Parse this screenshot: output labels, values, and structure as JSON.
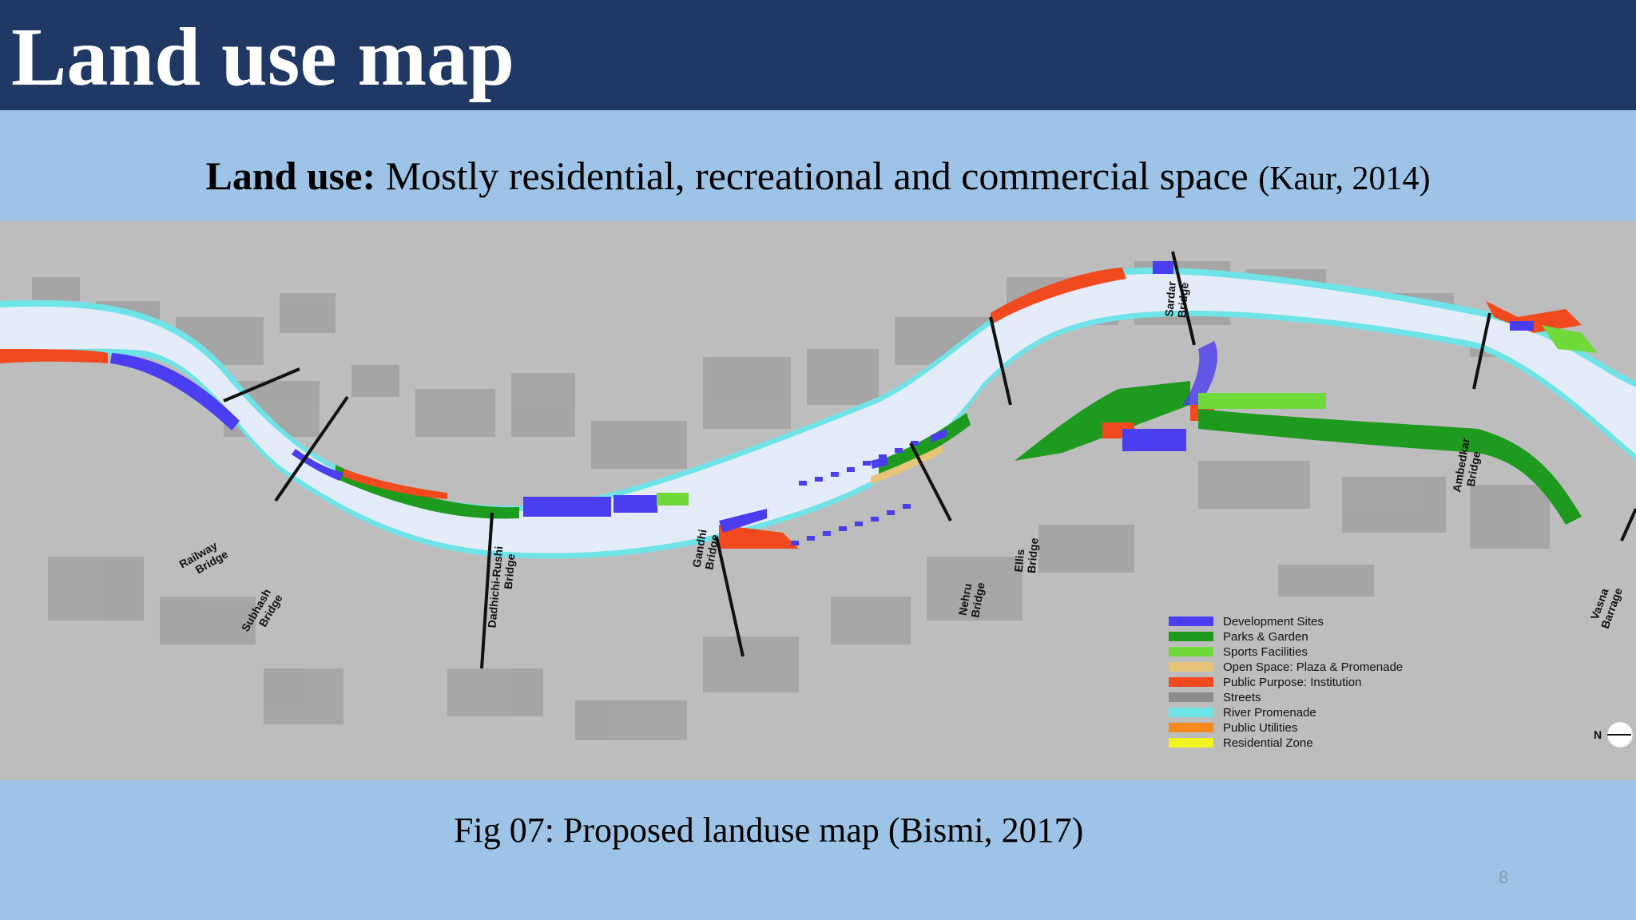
{
  "slide": {
    "title": "Land use map",
    "subtitle_label": "Land use:",
    "subtitle_text": " Mostly residential, recreational and commercial space ",
    "subtitle_citation": "(Kaur, 2014)",
    "caption": "Fig 07: Proposed landuse map (Bismi, 2017)",
    "page_number": "8"
  },
  "map": {
    "bridges": [
      {
        "lines": [
          "Railway",
          "Bridge"
        ]
      },
      {
        "lines": [
          "Subhash",
          "Bridge"
        ]
      },
      {
        "lines": [
          "Dadhichi-Rushi",
          "Bridge"
        ]
      },
      {
        "lines": [
          "Gandhi",
          "Bridge"
        ]
      },
      {
        "lines": [
          "Nehru",
          "Bridge"
        ]
      },
      {
        "lines": [
          "Ellis",
          "Bridge"
        ]
      },
      {
        "lines": [
          "Sardar",
          "Bridge"
        ]
      },
      {
        "lines": [
          "Ambedkar",
          "Bridge"
        ]
      },
      {
        "lines": [
          "Vasna",
          "Barrage"
        ]
      }
    ],
    "legend": [
      {
        "label": "Development Sites",
        "color": "#4b3df0"
      },
      {
        "label": "Parks & Garden",
        "color": "#1e9a1e"
      },
      {
        "label": "Sports Facilities",
        "color": "#6fd93a"
      },
      {
        "label": "Open Space: Plaza & Promenade",
        "color": "#e6c47a"
      },
      {
        "label": "Public Purpose: Institution",
        "color": "#f04a1e"
      },
      {
        "label": "Streets",
        "color": "#8c8c8c"
      },
      {
        "label": "River Promenade",
        "color": "#6ee3e8"
      },
      {
        "label": "Public Utilities",
        "color": "#f58a1e"
      },
      {
        "label": "Residential Zone",
        "color": "#f2f21e"
      }
    ],
    "north_label": "N",
    "colors": {
      "river": "#e3ecf8",
      "river_edge": "#6ee3e8",
      "land": "#bdbdbd",
      "built": "#9a9a9a"
    }
  }
}
